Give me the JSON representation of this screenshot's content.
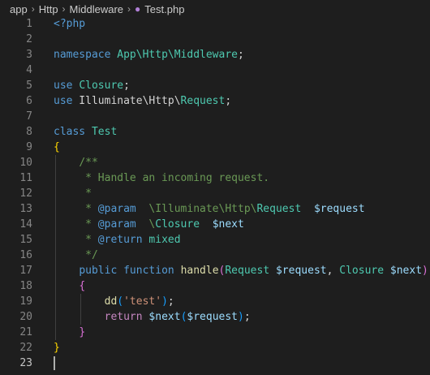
{
  "breadcrumb": {
    "items": [
      "app",
      "Http",
      "Middleware"
    ],
    "file": "Test.php",
    "separator": "›",
    "file_icon": "php-elephant-icon"
  },
  "editor": {
    "active_line": 23,
    "lines": [
      {
        "n": "1",
        "tokens": [
          [
            "kw",
            "<?php"
          ]
        ]
      },
      {
        "n": "2",
        "tokens": []
      },
      {
        "n": "3",
        "tokens": [
          [
            "kw",
            "namespace"
          ],
          [
            "plain",
            " "
          ],
          [
            "cls",
            "App\\Http\\Middleware"
          ],
          [
            "plain",
            ";"
          ]
        ]
      },
      {
        "n": "4",
        "tokens": []
      },
      {
        "n": "5",
        "tokens": [
          [
            "kw",
            "use"
          ],
          [
            "plain",
            " "
          ],
          [
            "cls",
            "Closure"
          ],
          [
            "plain",
            ";"
          ]
        ]
      },
      {
        "n": "6",
        "tokens": [
          [
            "kw",
            "use"
          ],
          [
            "plain",
            " Illuminate\\Http\\"
          ],
          [
            "cls",
            "Request"
          ],
          [
            "plain",
            ";"
          ]
        ]
      },
      {
        "n": "7",
        "tokens": []
      },
      {
        "n": "8",
        "tokens": [
          [
            "kw",
            "class"
          ],
          [
            "plain",
            " "
          ],
          [
            "cls",
            "Test"
          ]
        ]
      },
      {
        "n": "9",
        "tokens": [
          [
            "b1",
            "{"
          ]
        ]
      },
      {
        "n": "10",
        "tokens": [
          [
            "plain",
            "    "
          ],
          [
            "cmt",
            "/**"
          ]
        ]
      },
      {
        "n": "11",
        "tokens": [
          [
            "plain",
            "    "
          ],
          [
            "cmt",
            " * Handle an incoming request."
          ]
        ]
      },
      {
        "n": "12",
        "tokens": [
          [
            "plain",
            "    "
          ],
          [
            "cmt",
            " *"
          ]
        ]
      },
      {
        "n": "13",
        "tokens": [
          [
            "plain",
            "    "
          ],
          [
            "cmt",
            " * "
          ],
          [
            "kw",
            "@param"
          ],
          [
            "cmt",
            "  \\Illuminate\\Http\\"
          ],
          [
            "cls",
            "Request"
          ],
          [
            "cmt",
            "  "
          ],
          [
            "var",
            "$request"
          ]
        ]
      },
      {
        "n": "14",
        "tokens": [
          [
            "plain",
            "    "
          ],
          [
            "cmt",
            " * "
          ],
          [
            "kw",
            "@param"
          ],
          [
            "cmt",
            "  \\"
          ],
          [
            "cls",
            "Closure"
          ],
          [
            "cmt",
            "  "
          ],
          [
            "var",
            "$next"
          ]
        ]
      },
      {
        "n": "15",
        "tokens": [
          [
            "plain",
            "    "
          ],
          [
            "cmt",
            " * "
          ],
          [
            "kw",
            "@return"
          ],
          [
            "cmt",
            " "
          ],
          [
            "cls",
            "mixed"
          ]
        ]
      },
      {
        "n": "16",
        "tokens": [
          [
            "plain",
            "    "
          ],
          [
            "cmt",
            " */"
          ]
        ]
      },
      {
        "n": "17",
        "tokens": [
          [
            "plain",
            "    "
          ],
          [
            "kw",
            "public"
          ],
          [
            "plain",
            " "
          ],
          [
            "kw",
            "function"
          ],
          [
            "plain",
            " "
          ],
          [
            "fn",
            "handle"
          ],
          [
            "b2",
            "("
          ],
          [
            "cls",
            "Request"
          ],
          [
            "plain",
            " "
          ],
          [
            "var",
            "$request"
          ],
          [
            "plain",
            ", "
          ],
          [
            "cls",
            "Closure"
          ],
          [
            "plain",
            " "
          ],
          [
            "var",
            "$next"
          ],
          [
            "b2",
            ")"
          ]
        ]
      },
      {
        "n": "18",
        "tokens": [
          [
            "plain",
            "    "
          ],
          [
            "b2",
            "{"
          ]
        ]
      },
      {
        "n": "19",
        "tokens": [
          [
            "plain",
            "        "
          ],
          [
            "fn",
            "dd"
          ],
          [
            "b3",
            "("
          ],
          [
            "str",
            "'test'"
          ],
          [
            "b3",
            ")"
          ],
          [
            "plain",
            ";"
          ]
        ]
      },
      {
        "n": "20",
        "tokens": [
          [
            "plain",
            "        "
          ],
          [
            "ctl",
            "return"
          ],
          [
            "plain",
            " "
          ],
          [
            "var",
            "$next"
          ],
          [
            "b3",
            "("
          ],
          [
            "var",
            "$request"
          ],
          [
            "b3",
            ")"
          ],
          [
            "plain",
            ";"
          ]
        ]
      },
      {
        "n": "21",
        "tokens": [
          [
            "plain",
            "    "
          ],
          [
            "b2",
            "}"
          ]
        ]
      },
      {
        "n": "22",
        "tokens": [
          [
            "b1",
            "}"
          ]
        ]
      },
      {
        "n": "23",
        "tokens": []
      }
    ]
  }
}
